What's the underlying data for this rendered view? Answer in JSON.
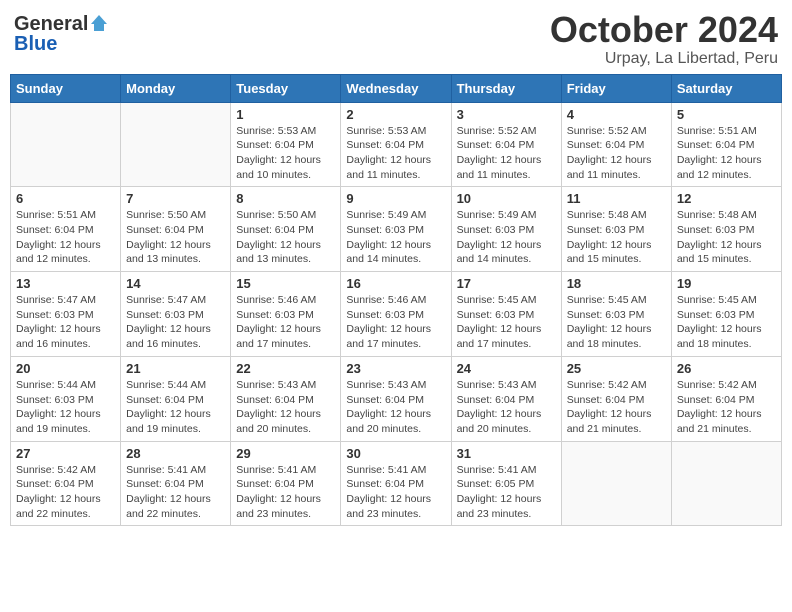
{
  "header": {
    "logo_general": "General",
    "logo_blue": "Blue",
    "month": "October 2024",
    "location": "Urpay, La Libertad, Peru"
  },
  "weekdays": [
    "Sunday",
    "Monday",
    "Tuesday",
    "Wednesday",
    "Thursday",
    "Friday",
    "Saturday"
  ],
  "weeks": [
    [
      {
        "day": "",
        "info": ""
      },
      {
        "day": "",
        "info": ""
      },
      {
        "day": "1",
        "info": "Sunrise: 5:53 AM\nSunset: 6:04 PM\nDaylight: 12 hours\nand 10 minutes."
      },
      {
        "day": "2",
        "info": "Sunrise: 5:53 AM\nSunset: 6:04 PM\nDaylight: 12 hours\nand 11 minutes."
      },
      {
        "day": "3",
        "info": "Sunrise: 5:52 AM\nSunset: 6:04 PM\nDaylight: 12 hours\nand 11 minutes."
      },
      {
        "day": "4",
        "info": "Sunrise: 5:52 AM\nSunset: 6:04 PM\nDaylight: 12 hours\nand 11 minutes."
      },
      {
        "day": "5",
        "info": "Sunrise: 5:51 AM\nSunset: 6:04 PM\nDaylight: 12 hours\nand 12 minutes."
      }
    ],
    [
      {
        "day": "6",
        "info": "Sunrise: 5:51 AM\nSunset: 6:04 PM\nDaylight: 12 hours\nand 12 minutes."
      },
      {
        "day": "7",
        "info": "Sunrise: 5:50 AM\nSunset: 6:04 PM\nDaylight: 12 hours\nand 13 minutes."
      },
      {
        "day": "8",
        "info": "Sunrise: 5:50 AM\nSunset: 6:04 PM\nDaylight: 12 hours\nand 13 minutes."
      },
      {
        "day": "9",
        "info": "Sunrise: 5:49 AM\nSunset: 6:03 PM\nDaylight: 12 hours\nand 14 minutes."
      },
      {
        "day": "10",
        "info": "Sunrise: 5:49 AM\nSunset: 6:03 PM\nDaylight: 12 hours\nand 14 minutes."
      },
      {
        "day": "11",
        "info": "Sunrise: 5:48 AM\nSunset: 6:03 PM\nDaylight: 12 hours\nand 15 minutes."
      },
      {
        "day": "12",
        "info": "Sunrise: 5:48 AM\nSunset: 6:03 PM\nDaylight: 12 hours\nand 15 minutes."
      }
    ],
    [
      {
        "day": "13",
        "info": "Sunrise: 5:47 AM\nSunset: 6:03 PM\nDaylight: 12 hours\nand 16 minutes."
      },
      {
        "day": "14",
        "info": "Sunrise: 5:47 AM\nSunset: 6:03 PM\nDaylight: 12 hours\nand 16 minutes."
      },
      {
        "day": "15",
        "info": "Sunrise: 5:46 AM\nSunset: 6:03 PM\nDaylight: 12 hours\nand 17 minutes."
      },
      {
        "day": "16",
        "info": "Sunrise: 5:46 AM\nSunset: 6:03 PM\nDaylight: 12 hours\nand 17 minutes."
      },
      {
        "day": "17",
        "info": "Sunrise: 5:45 AM\nSunset: 6:03 PM\nDaylight: 12 hours\nand 17 minutes."
      },
      {
        "day": "18",
        "info": "Sunrise: 5:45 AM\nSunset: 6:03 PM\nDaylight: 12 hours\nand 18 minutes."
      },
      {
        "day": "19",
        "info": "Sunrise: 5:45 AM\nSunset: 6:03 PM\nDaylight: 12 hours\nand 18 minutes."
      }
    ],
    [
      {
        "day": "20",
        "info": "Sunrise: 5:44 AM\nSunset: 6:03 PM\nDaylight: 12 hours\nand 19 minutes."
      },
      {
        "day": "21",
        "info": "Sunrise: 5:44 AM\nSunset: 6:04 PM\nDaylight: 12 hours\nand 19 minutes."
      },
      {
        "day": "22",
        "info": "Sunrise: 5:43 AM\nSunset: 6:04 PM\nDaylight: 12 hours\nand 20 minutes."
      },
      {
        "day": "23",
        "info": "Sunrise: 5:43 AM\nSunset: 6:04 PM\nDaylight: 12 hours\nand 20 minutes."
      },
      {
        "day": "24",
        "info": "Sunrise: 5:43 AM\nSunset: 6:04 PM\nDaylight: 12 hours\nand 20 minutes."
      },
      {
        "day": "25",
        "info": "Sunrise: 5:42 AM\nSunset: 6:04 PM\nDaylight: 12 hours\nand 21 minutes."
      },
      {
        "day": "26",
        "info": "Sunrise: 5:42 AM\nSunset: 6:04 PM\nDaylight: 12 hours\nand 21 minutes."
      }
    ],
    [
      {
        "day": "27",
        "info": "Sunrise: 5:42 AM\nSunset: 6:04 PM\nDaylight: 12 hours\nand 22 minutes."
      },
      {
        "day": "28",
        "info": "Sunrise: 5:41 AM\nSunset: 6:04 PM\nDaylight: 12 hours\nand 22 minutes."
      },
      {
        "day": "29",
        "info": "Sunrise: 5:41 AM\nSunset: 6:04 PM\nDaylight: 12 hours\nand 23 minutes."
      },
      {
        "day": "30",
        "info": "Sunrise: 5:41 AM\nSunset: 6:04 PM\nDaylight: 12 hours\nand 23 minutes."
      },
      {
        "day": "31",
        "info": "Sunrise: 5:41 AM\nSunset: 6:05 PM\nDaylight: 12 hours\nand 23 minutes."
      },
      {
        "day": "",
        "info": ""
      },
      {
        "day": "",
        "info": ""
      }
    ]
  ]
}
